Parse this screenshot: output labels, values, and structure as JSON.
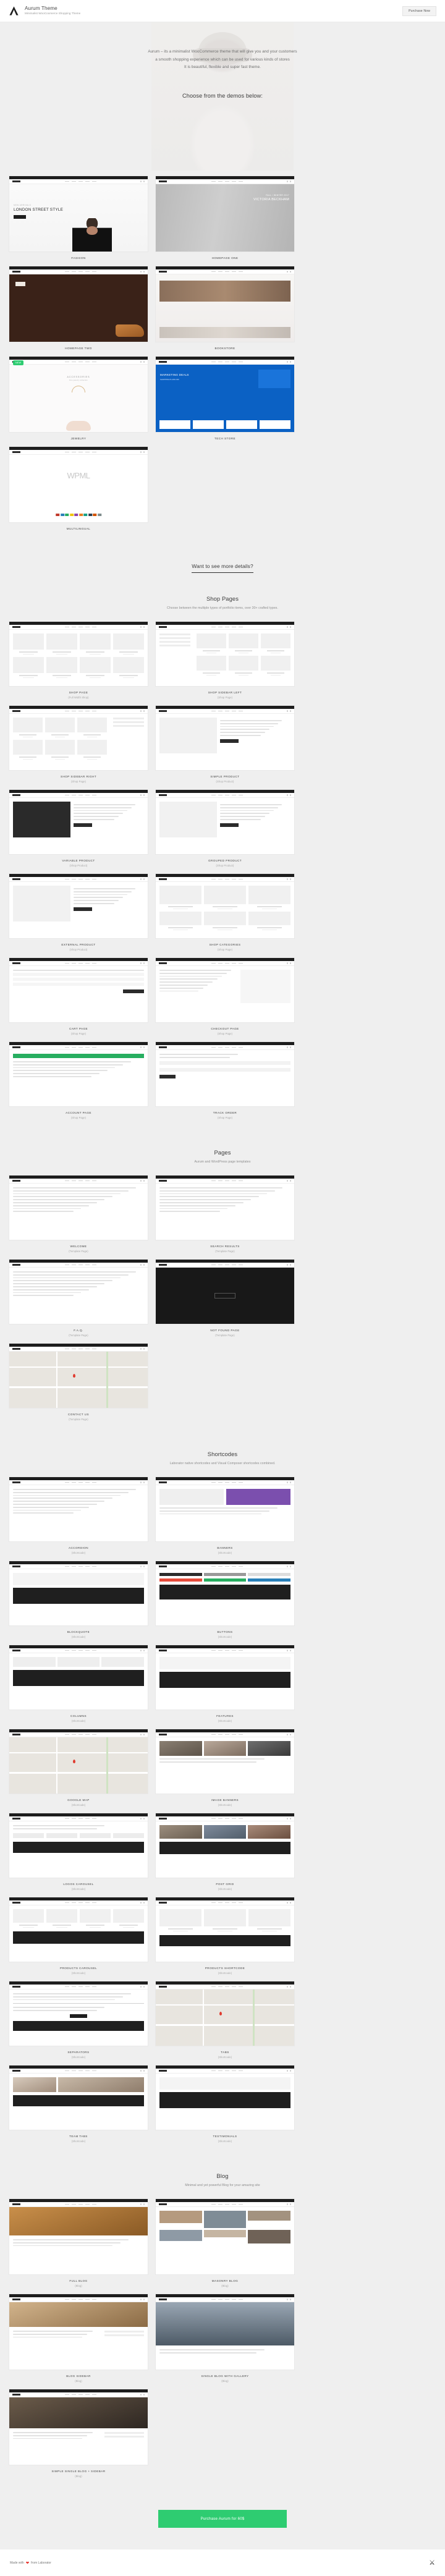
{
  "header": {
    "logo_icon": "aurum-logo-icon",
    "title": "Aurum Theme",
    "subtitle": "Minimalist WooCoomerce Shopping Theme",
    "purchase_label": "Purchase Now"
  },
  "hero": {
    "line1": "Aurum – its a minimalist WooCommerce theme that will give you and your customers",
    "line2": "a smooth shopping experience which can be used for various kinds of stores",
    "line3": "It is beautiful, flexible and super fast theme.",
    "cta": "Choose from the demos below:"
  },
  "demos": [
    {
      "label": "FASHION",
      "style": "fashion",
      "eyebrow": "NEW ARRIVALS",
      "title": "LONDON STREET STYLE",
      "badge": ""
    },
    {
      "label": "HOMEPAGE ONE",
      "style": "gray",
      "eyebrow": "FALL / WINTER 2017",
      "title": "VICTORIA BECKHAM",
      "badge": ""
    },
    {
      "label": "HOMEPAGE TWO",
      "style": "dark",
      "eyebrow": "",
      "title": "",
      "badge": ""
    },
    {
      "label": "BOOKSTORE",
      "style": "books",
      "eyebrow": "",
      "title": "",
      "badge": ""
    },
    {
      "label": "JEWELRY",
      "style": "jewel",
      "eyebrow": "ACCESSORIES",
      "title": "Fine jewelry collection",
      "badge": "NEW"
    },
    {
      "label": "TECH STORE",
      "style": "tech",
      "eyebrow": "SHOPPING PLANS OFF",
      "title": "MARKETING DEALS",
      "badge": ""
    },
    {
      "label": "MULTILINGUAL",
      "style": "wpml",
      "eyebrow": "",
      "title": "WPML",
      "badge": ""
    }
  ],
  "more_details": {
    "title": "Want to see more details?"
  },
  "shop": {
    "title": "Shop Pages",
    "subtitle": "Choose between the multiple types of portfolio items, over 30+ crafted types.",
    "items": [
      {
        "main": "SHOP PAGE",
        "sub": "(Full Width Shop)",
        "kind": "grid"
      },
      {
        "main": "SHOP SIDEBAR LEFT",
        "sub": "(Shop Page)",
        "kind": "sidebar-left"
      },
      {
        "main": "SHOP SIDEBAR RIGHT",
        "sub": "(Shop Page)",
        "kind": "sidebar-right"
      },
      {
        "main": "SIMPLE PRODUCT",
        "sub": "(Shop Product)",
        "kind": "product"
      },
      {
        "main": "VARIABLE PRODUCT",
        "sub": "(Shop Product)",
        "kind": "product-dark"
      },
      {
        "main": "GROUPED PRODUCT",
        "sub": "(Shop Product)",
        "kind": "product"
      },
      {
        "main": "EXTERNAL PRODUCT",
        "sub": "(Shop Product)",
        "kind": "product"
      },
      {
        "main": "SHOP CATEGORIES",
        "sub": "(Shop Page)",
        "kind": "categories"
      },
      {
        "main": "CART PAGE",
        "sub": "(Shop Page)",
        "kind": "cart"
      },
      {
        "main": "CHECKOUT PAGE",
        "sub": "(Shop Page)",
        "kind": "checkout"
      },
      {
        "main": "ACCOUNT PAGE",
        "sub": "(Shop Page)",
        "kind": "account"
      },
      {
        "main": "TRACK ORDER",
        "sub": "(Shop Page)",
        "kind": "track"
      }
    ]
  },
  "pages": {
    "title": "Pages",
    "subtitle": "Aurum and WordPress page templates",
    "items": [
      {
        "main": "WELCOME",
        "sub": "(Template Page)",
        "kind": "text"
      },
      {
        "main": "SEARCH RESULTS",
        "sub": "(Template Page)",
        "kind": "text"
      },
      {
        "main": "F.A.Q.",
        "sub": "(Template Page)",
        "kind": "text"
      },
      {
        "main": "NOT FOUND PAGE",
        "sub": "(Template Page)",
        "kind": "notfound"
      },
      {
        "main": "CONTACT US",
        "sub": "(Template Page)",
        "kind": "map"
      }
    ]
  },
  "shortcodes": {
    "title": "Shortcodes",
    "subtitle": "Laborator native shortcodes and Visual Composer shortcodes combined.",
    "items": [
      {
        "main": "ACCORDION",
        "sub": "(Shortcode)",
        "kind": "text"
      },
      {
        "main": "BANNERS",
        "sub": "(Shortcode)",
        "kind": "banners"
      },
      {
        "main": "BLOCKQUOTE",
        "sub": "(Shortcode)",
        "kind": "dark"
      },
      {
        "main": "BUTTONS",
        "sub": "(Shortcode)",
        "kind": "buttons"
      },
      {
        "main": "COLUMNS",
        "sub": "(Shortcode)",
        "kind": "columns"
      },
      {
        "main": "FEATURES",
        "sub": "(Shortcode)",
        "kind": "dark"
      },
      {
        "main": "GOOGLE MAP",
        "sub": "(Shortcode)",
        "kind": "map"
      },
      {
        "main": "IMAGE BANNERS",
        "sub": "(Shortcode)",
        "kind": "imgbanners"
      },
      {
        "main": "LOGOS CAROUSEL",
        "sub": "(Shortcode)",
        "kind": "logos"
      },
      {
        "main": "POST GRID",
        "sub": "(Shortcode)",
        "kind": "postgrid"
      },
      {
        "main": "PRODUCTS CAROUSEL",
        "sub": "(Shortcode)",
        "kind": "prodcarousel"
      },
      {
        "main": "PRODUCTS SHORTCODE",
        "sub": "(Shortcode)",
        "kind": "prodshort"
      },
      {
        "main": "SEPARATORS",
        "sub": "(Shortcode)",
        "kind": "separators"
      },
      {
        "main": "TABS",
        "sub": "(Shortcode)",
        "kind": "map"
      },
      {
        "main": "TEAM TABS",
        "sub": "(Shortcode)",
        "kind": "teamtabs"
      },
      {
        "main": "TESTIMONIALS",
        "sub": "(Shortcode)",
        "kind": "dark"
      }
    ]
  },
  "blog": {
    "title": "Blog",
    "subtitle": "Minimal and yet powerful Blog for your amazing site",
    "items": [
      {
        "main": "FULL BLOG",
        "sub": "(Blog)",
        "kind": "blogfull"
      },
      {
        "main": "MASONRY BLOG",
        "sub": "(Blog)",
        "kind": "masonry"
      },
      {
        "main": "BLOG SIDEBAR",
        "sub": "(Blog)",
        "kind": "blogside"
      },
      {
        "main": "SINGLE BLOG WITH GALLERY",
        "sub": "(Blog)",
        "kind": "blogsingle"
      },
      {
        "main": "SIMPLE SINGLE BLOG + SIDEBAR",
        "sub": "(Blog)",
        "kind": "blogsimple"
      }
    ]
  },
  "footer": {
    "cta_label": "Purchase Aurum for 60$",
    "cta_color": "#2ecc71",
    "made_prefix": "Made with",
    "heart_icon": "heart-icon",
    "made_suffix": "from Laborator",
    "flask_icon": "flask-icon"
  }
}
